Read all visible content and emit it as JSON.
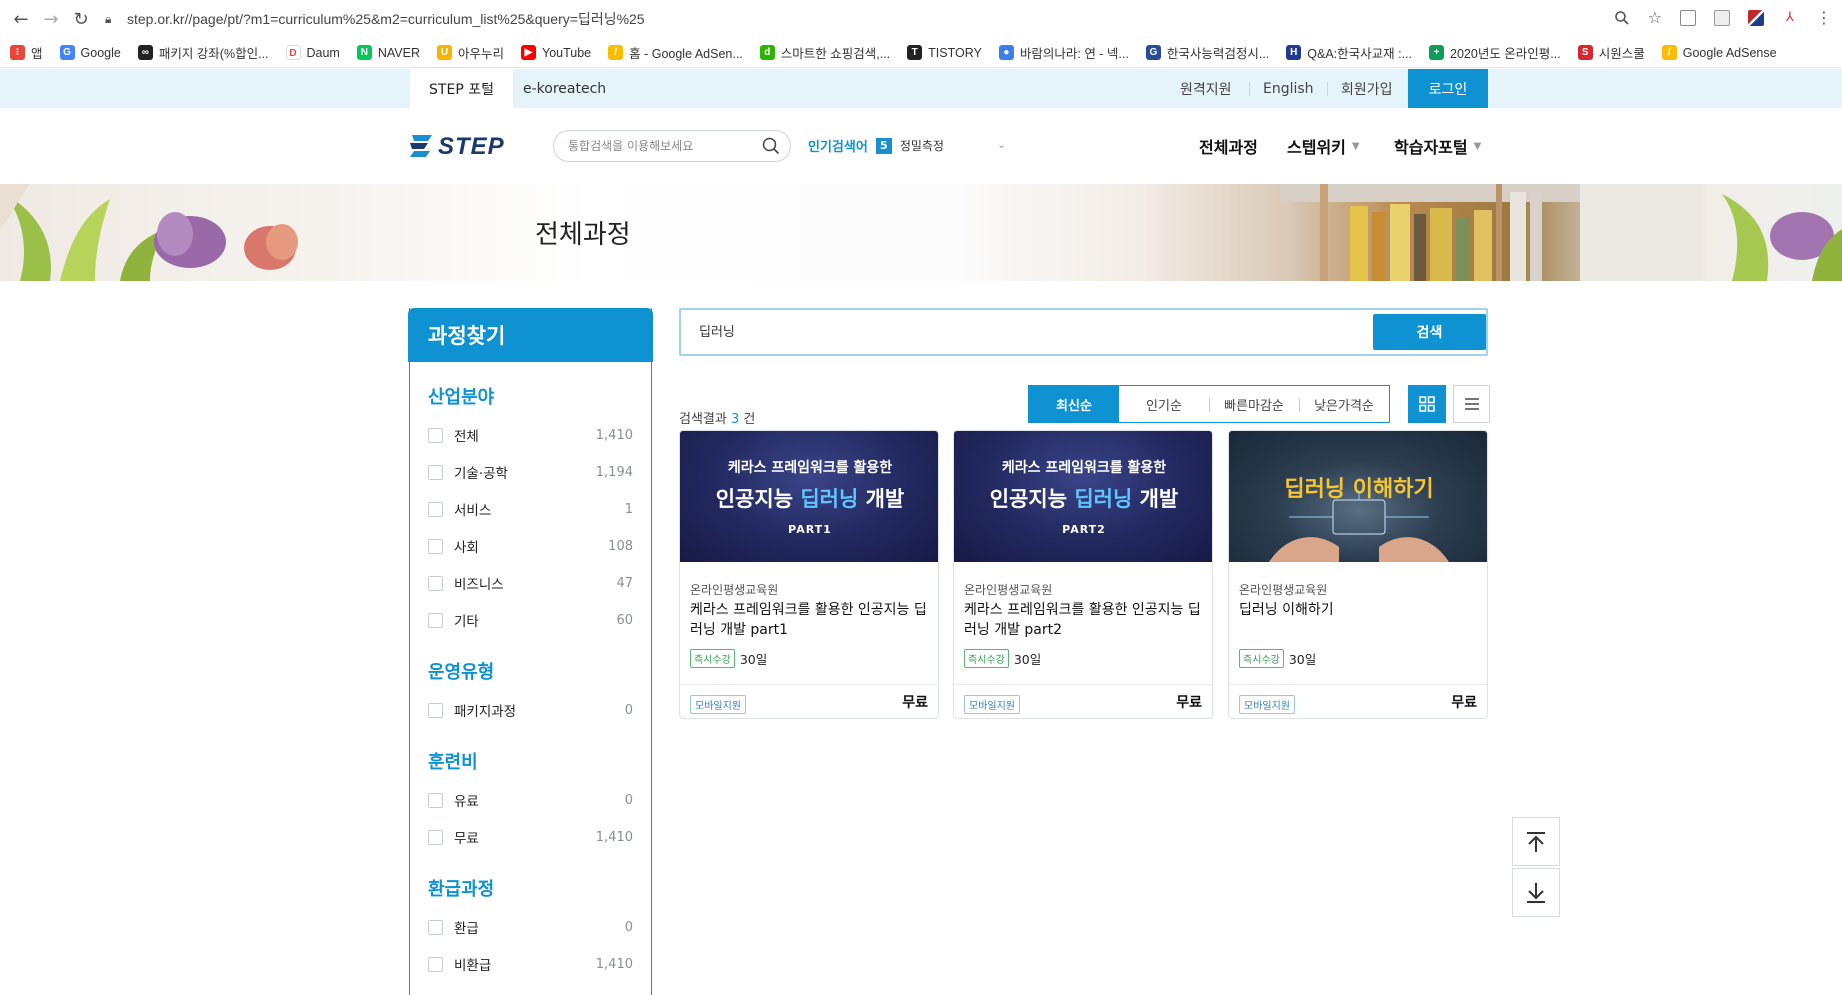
{
  "browser": {
    "url": "step.or.kr//page/pt/?m1=curriculum%25&m2=curriculum_list%25&query=딥러닝%25",
    "bookmarks": [
      {
        "label": "앱",
        "color": "#e8453c",
        "glyph": "⁝"
      },
      {
        "label": "Google",
        "color": "#4285f4",
        "glyph": "G"
      },
      {
        "label": "패키지 강좌(%합인...",
        "color": "#222222",
        "glyph": "∞"
      },
      {
        "label": "Daum",
        "color": "#ffffff",
        "glyph": "D"
      },
      {
        "label": "NAVER",
        "color": "#03c75a",
        "glyph": "N"
      },
      {
        "label": "아우누리",
        "color": "#f4b400",
        "glyph": "U"
      },
      {
        "label": "YouTube",
        "color": "#ff0000",
        "glyph": "▶"
      },
      {
        "label": "홈 - Google AdSen...",
        "color": "#fbbc04",
        "glyph": "/"
      },
      {
        "label": "스마트한 쇼핑검색,...",
        "color": "#2db400",
        "glyph": "d"
      },
      {
        "label": "TISTORY",
        "color": "#222222",
        "glyph": "T"
      },
      {
        "label": "바람의나라: 연 - 넥...",
        "color": "#3d7ee8",
        "glyph": "●"
      },
      {
        "label": "한국사능력검정시...",
        "color": "#2b4c9a",
        "glyph": "G"
      },
      {
        "label": "Q&A:한국사교재 :...",
        "color": "#233b8f",
        "glyph": "H"
      },
      {
        "label": "2020년도 온라인평...",
        "color": "#0f9d58",
        "glyph": "+"
      },
      {
        "label": "시원스쿨",
        "color": "#d7282f",
        "glyph": "S"
      },
      {
        "label": "Google AdSense",
        "color": "#fbbc04",
        "glyph": "/"
      }
    ]
  },
  "topstrip": {
    "portal": "STEP 포털",
    "ekoreatech": "e-koreatech",
    "remote": "원격지원",
    "english": "English",
    "signup": "회원가입",
    "login": "로그인"
  },
  "header": {
    "logo": "STEP",
    "search_placeholder": "통합검색을 이용해보세요",
    "popular_label": "인기검색어",
    "popular_rank": "5",
    "popular_keyword": "정밀측정",
    "nav": [
      "전체과정",
      "스텝위키",
      "학습자포털"
    ]
  },
  "banner": {
    "title": "전체과정"
  },
  "sidebar": {
    "title": "과정찾기",
    "groups": [
      {
        "title": "산업분야",
        "items": [
          {
            "label": "전체",
            "count": "1,410"
          },
          {
            "label": "기술·공학",
            "count": "1,194"
          },
          {
            "label": "서비스",
            "count": "1"
          },
          {
            "label": "사회",
            "count": "108"
          },
          {
            "label": "비즈니스",
            "count": "47"
          },
          {
            "label": "기타",
            "count": "60"
          }
        ]
      },
      {
        "title": "운영유형",
        "items": [
          {
            "label": "패키지과정",
            "count": "0"
          }
        ]
      },
      {
        "title": "훈련비",
        "items": [
          {
            "label": "유료",
            "count": "0"
          },
          {
            "label": "무료",
            "count": "1,410"
          }
        ]
      },
      {
        "title": "환급과정",
        "items": [
          {
            "label": "환급",
            "count": "0"
          },
          {
            "label": "비환급",
            "count": "1,410"
          }
        ]
      }
    ]
  },
  "main": {
    "query": "딥러닝",
    "search_button": "검색",
    "result_prefix": "검색결과",
    "result_count": "3",
    "result_suffix": "건",
    "sort_tabs": [
      "최신순",
      "인기순",
      "빠른마감순",
      "낮은가격순"
    ],
    "cards": [
      {
        "thumb_line1": "케라스 프레임워크를 활용한",
        "thumb_line2_pre": "인공지능 ",
        "thumb_line2_hl": "딥러닝",
        "thumb_line2_post": " 개발",
        "thumb_part": "PART1",
        "org": "온라인평생교육원",
        "title": "케라스 프레임워크를 활용한 인공지능 딥러닝 개발 part1",
        "badge": "즉시수강",
        "days": "30일",
        "mobile": "모바일지원",
        "price": "무료"
      },
      {
        "thumb_line1": "케라스 프레임워크를 활용한",
        "thumb_line2_pre": "인공지능 ",
        "thumb_line2_hl": "딥러닝",
        "thumb_line2_post": " 개발",
        "thumb_part": "PART2",
        "org": "온라인평생교육원",
        "title": "케라스 프레임워크를 활용한 인공지능 딥러닝 개발 part2",
        "badge": "즉시수강",
        "days": "30일",
        "mobile": "모바일지원",
        "price": "무료"
      },
      {
        "thumb_title": "딥러닝 이해하기",
        "org": "온라인평생교육원",
        "title": "딥러닝 이해하기",
        "badge": "즉시수강",
        "days": "30일",
        "mobile": "모바일지원",
        "price": "무료"
      }
    ]
  },
  "colors": {
    "accent": "#0f92d2",
    "strip": "#e5f3fa"
  }
}
